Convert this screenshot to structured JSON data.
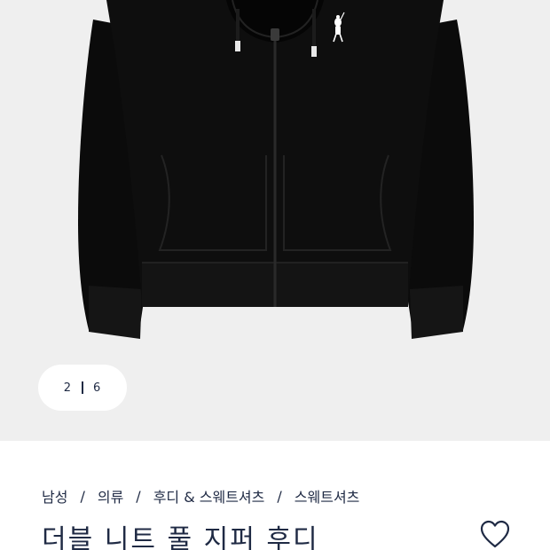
{
  "gallery": {
    "current_page": "2",
    "total_pages": "6",
    "image_alt": "Black full-zip hoodie with white pony logo"
  },
  "breadcrumb": [
    "남성",
    "의류",
    "후디 & 스웨트셔츠",
    "스웨트셔츠"
  ],
  "product": {
    "title": "더블 니트 풀 지퍼 후디"
  },
  "icons": {
    "wishlist": "heart-outline-icon",
    "logo": "polo-pony-logo"
  },
  "colors": {
    "text": "#1f2a44",
    "gallery_bg": "#efefef",
    "garment": "#0b0b0b"
  }
}
